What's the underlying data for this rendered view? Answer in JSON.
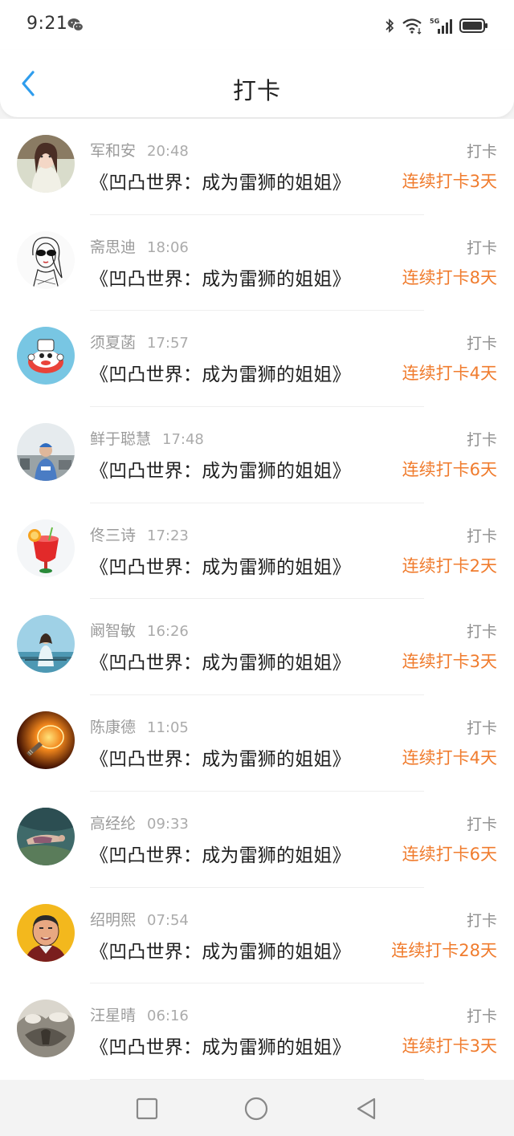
{
  "status_bar": {
    "time": "9:21",
    "icons": [
      "wechat-icon",
      "bluetooth-icon",
      "wifi-icon",
      "signal-5g-icon",
      "battery-icon"
    ]
  },
  "header": {
    "title": "打卡",
    "back_icon": "chevron-left-icon"
  },
  "colors": {
    "accent_back": "#2f9ded",
    "streak_orange": "#f07c2e",
    "muted_gray": "#9b9b9b"
  },
  "feed": {
    "items": [
      {
        "name": "军和安",
        "time": "20:48",
        "book": "《凹凸世界：成为雷狮的姐姐》",
        "action": "打卡",
        "streak": "连续打卡3天"
      },
      {
        "name": "斋思迪",
        "time": "18:06",
        "book": "《凹凸世界：成为雷狮的姐姐》",
        "action": "打卡",
        "streak": "连续打卡8天"
      },
      {
        "name": "须夏菡",
        "time": "17:57",
        "book": "《凹凸世界：成为雷狮的姐姐》",
        "action": "打卡",
        "streak": "连续打卡4天"
      },
      {
        "name": "鲜于聪慧",
        "time": "17:48",
        "book": "《凹凸世界：成为雷狮的姐姐》",
        "action": "打卡",
        "streak": "连续打卡6天"
      },
      {
        "name": "佟三诗",
        "time": "17:23",
        "book": "《凹凸世界：成为雷狮的姐姐》",
        "action": "打卡",
        "streak": "连续打卡2天"
      },
      {
        "name": "阚智敏",
        "time": "16:26",
        "book": "《凹凸世界：成为雷狮的姐姐》",
        "action": "打卡",
        "streak": "连续打卡3天"
      },
      {
        "name": "陈康德",
        "time": "11:05",
        "book": "《凹凸世界：成为雷狮的姐姐》",
        "action": "打卡",
        "streak": "连续打卡4天"
      },
      {
        "name": "高经纶",
        "time": "09:33",
        "book": "《凹凸世界：成为雷狮的姐姐》",
        "action": "打卡",
        "streak": "连续打卡6天"
      },
      {
        "name": "绍明熙",
        "time": "07:54",
        "book": "《凹凸世界：成为雷狮的姐姐》",
        "action": "打卡",
        "streak": "连续打卡28天"
      },
      {
        "name": "汪星晴",
        "time": "06:16",
        "book": "《凹凸世界：成为雷狮的姐姐》",
        "action": "打卡",
        "streak": "连续打卡3天"
      }
    ]
  },
  "nav_bar": {
    "buttons": [
      "recents-square-icon",
      "home-circle-icon",
      "back-triangle-icon"
    ]
  }
}
